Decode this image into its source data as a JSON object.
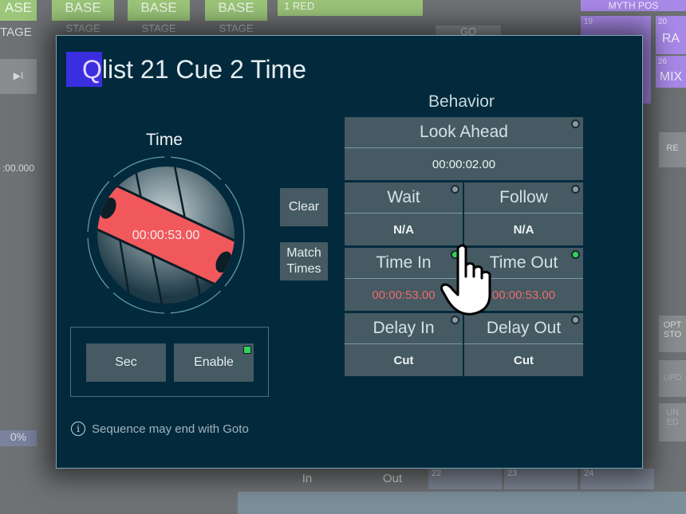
{
  "background": {
    "top_tiles": [
      "ASE",
      "BASE",
      "BASE",
      "BASE"
    ],
    "stage_labels": [
      "TAGE",
      "STAGE",
      "STAGE",
      "STAGE"
    ],
    "red_label": "1 RED",
    "go_label": "GO",
    "myth_label": "MYTH POS",
    "right_tiles": [
      {
        "num": "19",
        "label": ""
      },
      {
        "num": "20",
        "label": "RA"
      },
      {
        "num": "26",
        "label": "MIX"
      }
    ],
    "left_time": ":00.000",
    "left_percent": "0%",
    "right_buttons": [
      "RE",
      "OPT",
      "STO",
      "UPD",
      "UN",
      "ED"
    ],
    "bottom_in": "In",
    "bottom_out": "Out",
    "bottom_nums": [
      "22",
      "23",
      "24"
    ]
  },
  "dialog": {
    "title_highlight": "Q",
    "title_rest": "list 21 Cue 2 Time",
    "time_section": "Time",
    "dial_value": "00:00:53.00",
    "clear_label": "Clear",
    "match_times_label": "Match Times",
    "sec_label": "Sec",
    "enable_label": "Enable",
    "enable_on": true,
    "note": "Sequence may end with Goto",
    "behavior_title": "Behavior",
    "look_ahead": {
      "label": "Look Ahead",
      "value": "00:00:02.00",
      "indicator": false
    },
    "wait": {
      "label": "Wait",
      "value": "N/A",
      "indicator": false
    },
    "follow": {
      "label": "Follow",
      "value": "N/A",
      "indicator": false
    },
    "time_in": {
      "label": "Time In",
      "value": "00:00:53.00",
      "indicator": true
    },
    "time_out": {
      "label": "Time Out",
      "value": "00:00:53.00",
      "indicator": true
    },
    "delay_in": {
      "label": "Delay In",
      "value": "Cut",
      "indicator": false
    },
    "delay_out": {
      "label": "Delay Out",
      "value": "Cut",
      "indicator": false
    }
  },
  "colors": {
    "dialog_bg": "#032a3c",
    "button": "#455a62",
    "accent_red": "#f06a6a",
    "indicator_on": "#33d35a",
    "title_highlight": "#3a2ee0"
  }
}
